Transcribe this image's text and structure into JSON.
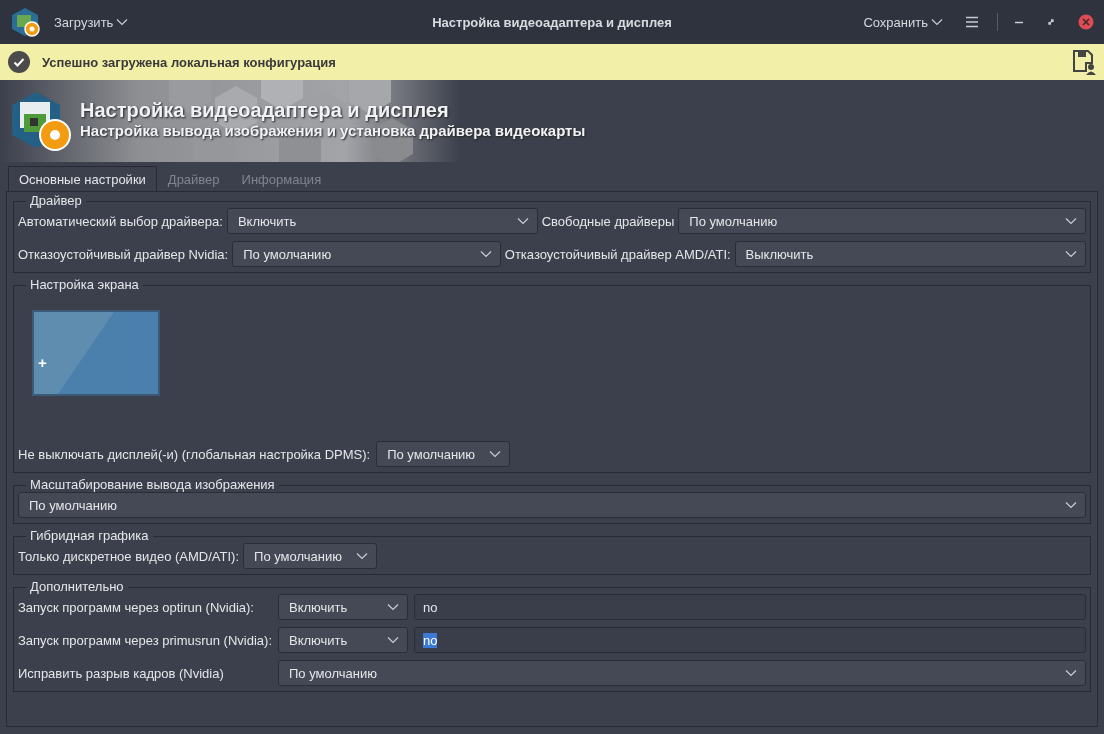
{
  "window": {
    "title": "Настройка видеоадаптера и дисплея",
    "menu_left": "Загрузить",
    "menu_right": "Сохранить"
  },
  "notification": {
    "text": "Успешно загружена локальная конфигурация"
  },
  "header": {
    "title": "Настройка видеоадаптера и дисплея",
    "subtitle": "Настройка вывода изображения и установка драйвера видеокарты"
  },
  "tabs": [
    {
      "label": "Основные настройки",
      "selected": true
    },
    {
      "label": "Драйвер",
      "selected": false
    },
    {
      "label": "Информация",
      "selected": false
    }
  ],
  "groups": [
    {
      "title": "Драйвер",
      "kind": "rows",
      "rows": [
        [
          {
            "kind": "label",
            "text": "Автоматический выбор драйвера:"
          },
          {
            "kind": "combo",
            "value": "Включить"
          },
          {
            "kind": "label",
            "text": "Свободные драйверы"
          },
          {
            "kind": "combo-wide",
            "value": "По умолчанию"
          }
        ],
        [
          {
            "kind": "label",
            "text": "Отказоустойчивый драйвер Nvidia:"
          },
          {
            "kind": "combo",
            "value": "По умолчанию"
          },
          {
            "kind": "label",
            "text": "Отказоустойчивый драйвер AMD/ATI:"
          },
          {
            "kind": "combo",
            "value": "Выключить"
          }
        ]
      ]
    },
    {
      "title": "Настройка экрана",
      "kind": "screen",
      "screen_mark": "+",
      "rows": [
        [
          {
            "kind": "label",
            "text": "Не выключать дисплей(-и) (глобальная настройка DPMS):"
          },
          {
            "kind": "compact",
            "value": "По умолчанию"
          }
        ]
      ]
    },
    {
      "title": "Масштабирование вывода изображения",
      "kind": "rows",
      "rows": [
        [
          {
            "kind": "combo",
            "value": "По умолчанию"
          }
        ]
      ]
    },
    {
      "title": "Гибридная графика",
      "kind": "rows",
      "rows": [
        [
          {
            "kind": "label",
            "text": "Только дискретное видео (AMD/ATI):"
          },
          {
            "kind": "compact",
            "value": "По умолчанию"
          }
        ]
      ]
    },
    {
      "title": "Дополнительно",
      "kind": "grid",
      "rows": [
        [
          {
            "kind": "label",
            "text": "Запуск программ через optirun (Nvidia):"
          },
          {
            "kind": "combo",
            "value": "Включить"
          },
          {
            "kind": "input",
            "value": "no",
            "selected": false
          }
        ],
        [
          {
            "kind": "label",
            "text": "Запуск программ через primusrun (Nvidia):"
          },
          {
            "kind": "combo",
            "value": "Включить"
          },
          {
            "kind": "input",
            "value": "no",
            "selected": true
          }
        ],
        [
          {
            "kind": "label",
            "text": "Исправить разрыв кадров (Nvidia)"
          },
          {
            "kind": "combo-span",
            "value": "По умолчанию"
          }
        ]
      ]
    }
  ]
}
